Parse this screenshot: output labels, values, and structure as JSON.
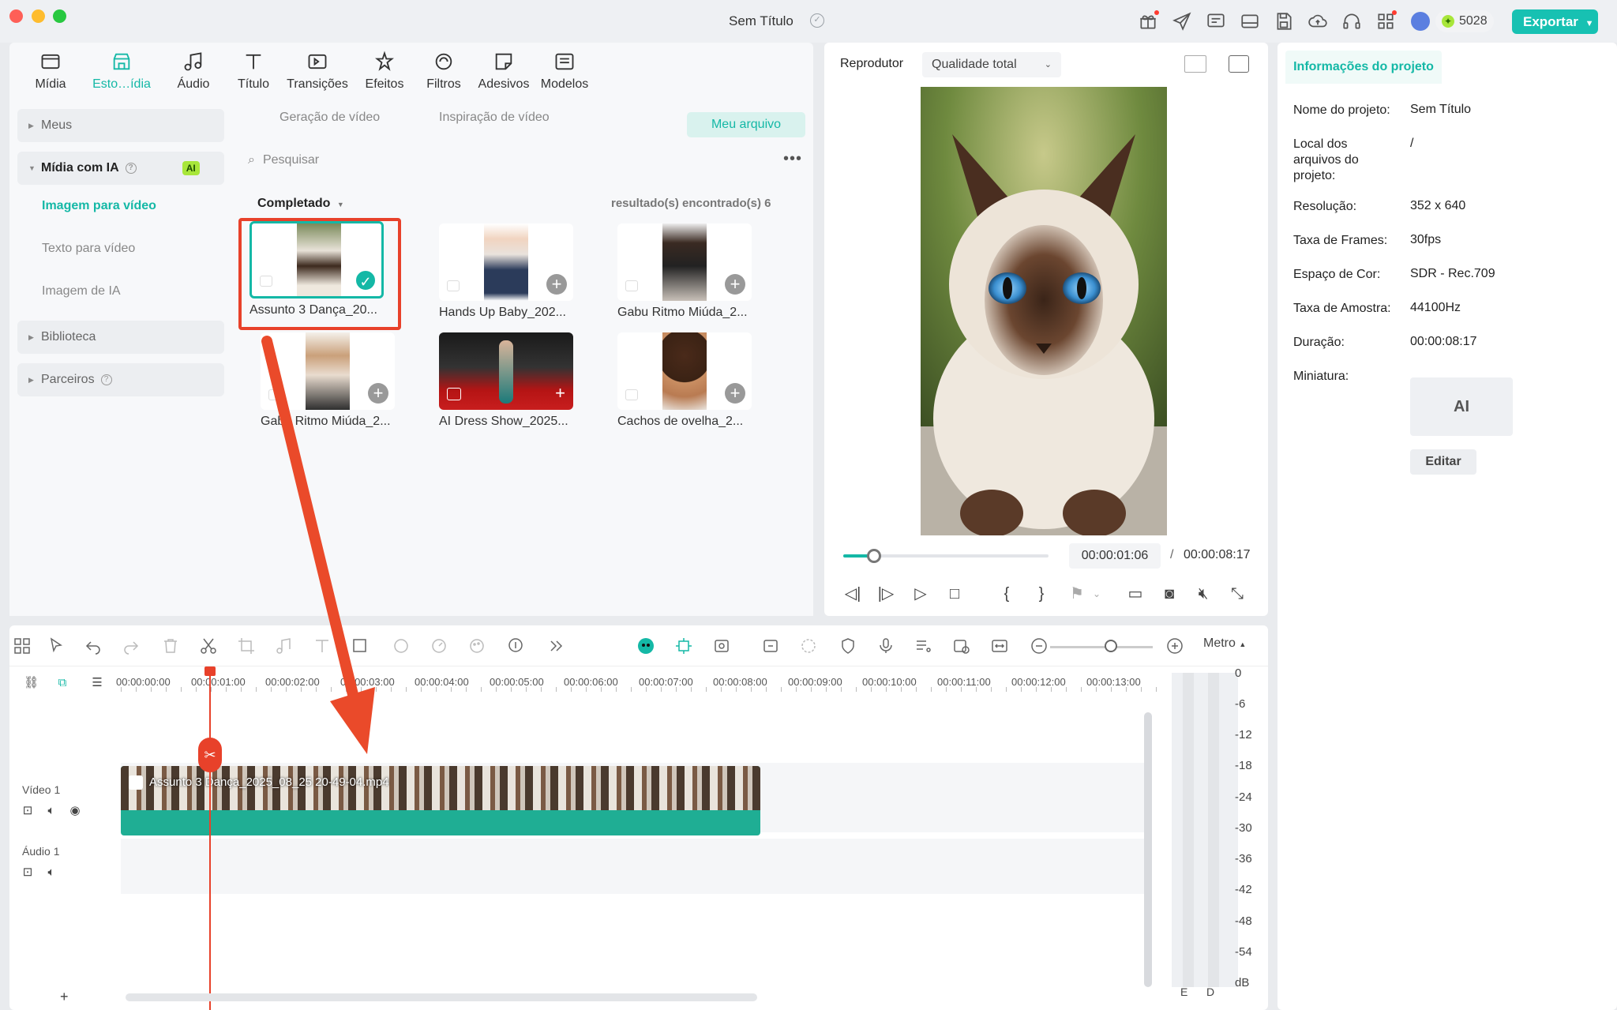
{
  "window": {
    "title": "Sem Título",
    "credits": "5028",
    "export_label": "Exportar"
  },
  "media_tabs": [
    {
      "label": "Mídia"
    },
    {
      "label": "Esto…ídia"
    },
    {
      "label": "Áudio"
    },
    {
      "label": "Título"
    },
    {
      "label": "Transições"
    },
    {
      "label": "Efeitos"
    },
    {
      "label": "Filtros"
    },
    {
      "label": "Adesivos"
    },
    {
      "label": "Modelos"
    }
  ],
  "sidebar": {
    "meus": "Meus",
    "midia_ia": "Mídia com IA",
    "ai_badge": "AI",
    "sub_items": [
      "Imagem para vídeo",
      "Texto para vídeo",
      "Imagem de IA"
    ],
    "biblioteca": "Biblioteca",
    "parceiros": "Parceiros"
  },
  "content": {
    "subtabs": [
      "Geração de vídeo",
      "Inspiração de vídeo"
    ],
    "meu_arquivo": "Meu arquivo",
    "search_placeholder": "Pesquisar",
    "filter_label": "Completado",
    "results_count": "resultado(s) encontrado(s) 6",
    "items": [
      {
        "caption": "Assunto 3 Dança_20..."
      },
      {
        "caption": "Hands Up Baby_202..."
      },
      {
        "caption": "Gabu Ritmo Miúda_2..."
      },
      {
        "caption": "Gabu Ritmo Miúda_2..."
      },
      {
        "caption": "AI Dress Show_2025..."
      },
      {
        "caption": "Cachos de ovelha_2..."
      }
    ]
  },
  "player": {
    "label": "Reprodutor",
    "quality": "Qualidade total",
    "current_time": "00:00:01:06",
    "separator": "/",
    "total_time": "00:00:08:17",
    "progress_fraction": 0.15
  },
  "project_info": {
    "tab": "Informações do projeto",
    "rows": [
      {
        "label": "Nome do projeto:",
        "value": "Sem Título"
      },
      {
        "label": "Local dos arquivos do projeto:",
        "value": "/"
      },
      {
        "label": "Resolução:",
        "value": "352 x 640"
      },
      {
        "label": "Taxa de Frames:",
        "value": "30fps"
      },
      {
        "label": "Espaço de Cor:",
        "value": "SDR - Rec.709"
      },
      {
        "label": "Taxa de Amostra:",
        "value": "44100Hz"
      },
      {
        "label": "Duração:",
        "value": "00:00:08:17"
      },
      {
        "label": "Miniatura:",
        "value": ""
      }
    ],
    "thumb_text": "AI",
    "edit_label": "Editar"
  },
  "timeline": {
    "zoom_mode": "Metro",
    "ruler": [
      "00:00:00:00",
      "00:00:01:00",
      "00:00:02:00",
      "00:00:03:00",
      "00:00:04:00",
      "00:00:05:00",
      "00:00:06:00",
      "00:00:07:00",
      "00:00:08:00",
      "00:00:09:00",
      "00:00:10:00",
      "00:00:11:00",
      "00:00:12:00",
      "00:00:13:00"
    ],
    "video_track": "Vídeo 1",
    "audio_track": "Áudio 1",
    "clip_name": "Assunto 3 Dança_2025_08_25 20-49-04.mp4",
    "meter_db": [
      "0",
      "-6",
      "-12",
      "-18",
      "-24",
      "-30",
      "-36",
      "-42",
      "-48",
      "-54",
      "dB"
    ],
    "meter_channels": [
      "E",
      "D"
    ]
  }
}
